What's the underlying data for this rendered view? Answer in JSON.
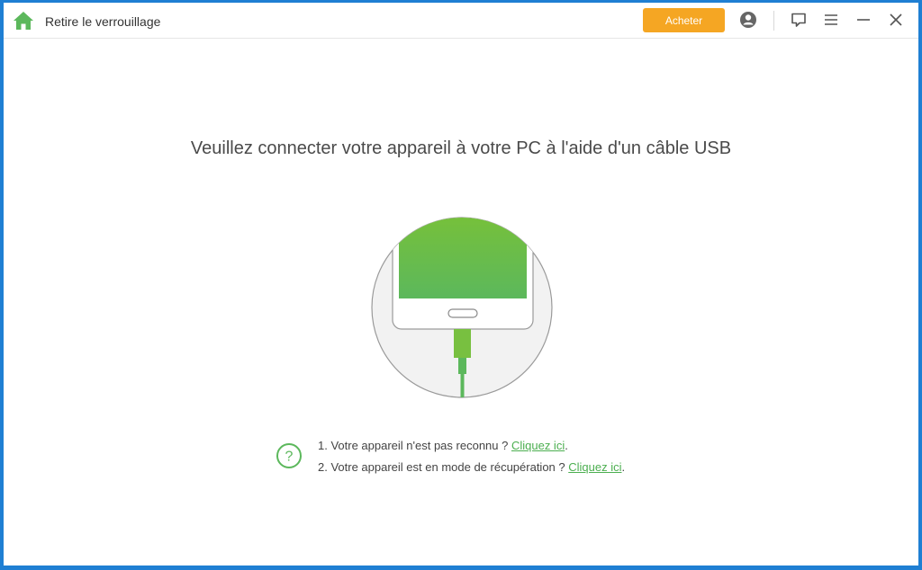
{
  "window": {
    "title": "Retire le verrouillage",
    "buy_label": "Acheter",
    "accent_color": "#5cb85c",
    "buy_color": "#f5a623",
    "icons": [
      "home-icon",
      "account-icon",
      "feedback-icon",
      "menu-icon",
      "minimize-icon",
      "close-icon"
    ]
  },
  "main": {
    "headline": "Veuillez connecter votre appareil à votre PC à l'aide d'un câble USB",
    "illustration_icon": "phone-usb-connection-icon",
    "help": {
      "icon": "help-circle-icon",
      "lines": [
        {
          "text": "1. Votre appareil n'est pas reconnu ? ",
          "link": "Cliquez ici",
          "suffix": "."
        },
        {
          "text": "2. Votre appareil est en mode de récupération ? ",
          "link": "Cliquez ici",
          "suffix": "."
        }
      ]
    }
  }
}
